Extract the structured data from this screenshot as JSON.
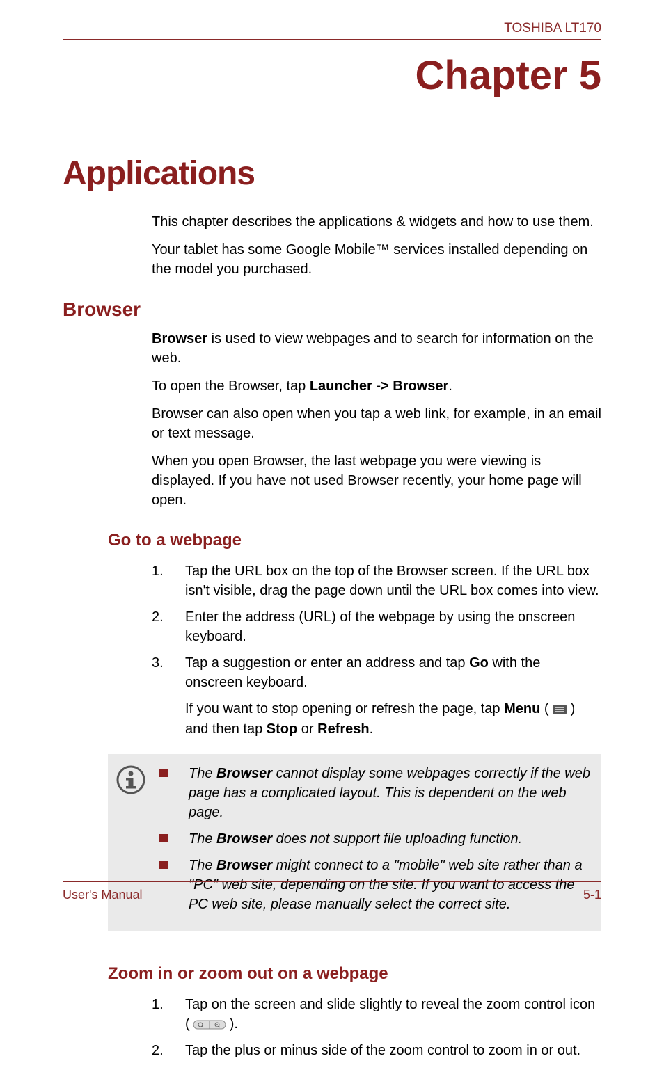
{
  "header": {
    "model": "TOSHIBA LT170"
  },
  "chapter": {
    "title": "Chapter 5"
  },
  "h1": "Applications",
  "intro": {
    "p1": "This chapter describes the applications & widgets and how to use them.",
    "p2": "Your tablet has some Google Mobile™ services installed depending on the model you purchased."
  },
  "browser": {
    "title": "Browser",
    "p1_pre": "Browser",
    "p1_rest": " is used to view webpages and to search for information on the web.",
    "p2_pre": "To open the Browser, tap ",
    "p2_bold": "Launcher -> Browser",
    "p2_post": ".",
    "p3": "Browser can also open when you tap a web link, for example, in an email or text message.",
    "p4": "When you open Browser, the last webpage you were viewing is displayed. If you have not used Browser recently, your home page will open."
  },
  "goto": {
    "title": "Go to a webpage",
    "steps": [
      "Tap the URL box on the top of the Browser screen. If the URL box isn't visible, drag the page down until the URL box comes into view.",
      "Enter the address (URL) of the webpage by using the onscreen keyboard."
    ],
    "step3_pre": "Tap a suggestion or enter an address and tap ",
    "step3_bold": "Go",
    "step3_post": " with the onscreen keyboard.",
    "step3_note_pre": "If you want to stop opening or refresh the page, tap ",
    "step3_note_menu": "Menu",
    "step3_note_mid": " ( ",
    "step3_note_mid2": " ) and then tap ",
    "step3_note_stop": "Stop",
    "step3_note_or": " or ",
    "step3_note_refresh": "Refresh",
    "step3_note_end": "."
  },
  "info": {
    "b1_pre": "The ",
    "b1_bold": "Browser",
    "b1_post": " cannot display some webpages correctly if the web page has a complicated layout. This is dependent on the web page.",
    "b2_pre": "The ",
    "b2_bold": "Browser",
    "b2_post": " does not support file uploading function.",
    "b3_pre": "The ",
    "b3_bold": "Browser",
    "b3_post": " might connect to a \"mobile\" web site rather than a \"PC\" web site, depending on the site. If you want to access the PC web site, please manually select the correct site."
  },
  "zoom": {
    "title": "Zoom in or zoom out on a webpage",
    "step1_pre": "Tap on the screen and slide slightly to reveal the zoom control icon ( ",
    "step1_post": " ).",
    "step2": "Tap the plus or minus side of the zoom control to zoom in or out."
  },
  "footer": {
    "left": "User's Manual",
    "right": "5-1"
  },
  "nums": {
    "n1": "1.",
    "n2": "2.",
    "n3": "3."
  }
}
